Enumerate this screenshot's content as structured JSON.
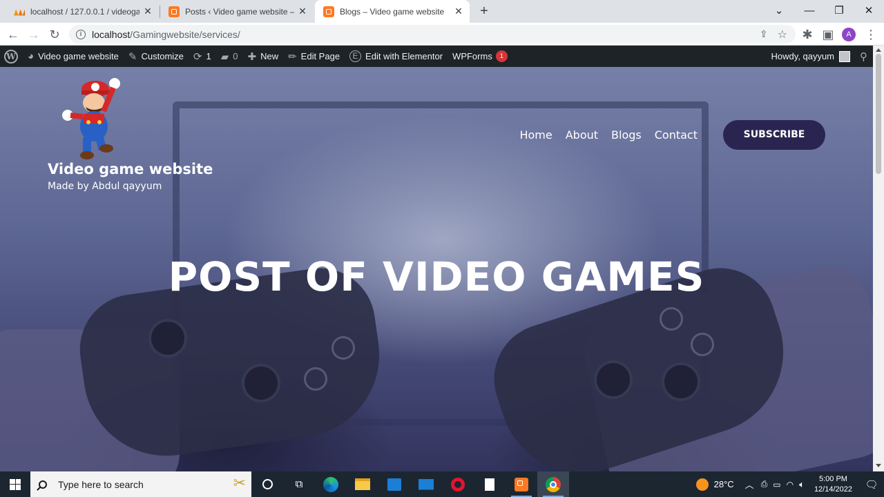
{
  "browser": {
    "tabs": [
      {
        "title": "localhost / 127.0.0.1 / videogame",
        "favicon": "phpmyadmin-icon",
        "active": false
      },
      {
        "title": "Posts ‹ Video game website — W",
        "favicon": "xampp-icon",
        "active": false
      },
      {
        "title": "Blogs – Video game website",
        "favicon": "xampp-icon",
        "active": true
      }
    ],
    "new_tab": "+",
    "url_host": "localhost",
    "url_path": "/Gamingwebsite/services/",
    "profile_initial": "A"
  },
  "wp_admin_bar": {
    "site_name": "Video game website",
    "customize": "Customize",
    "updates_count": "1",
    "comments_count": "0",
    "new": "New",
    "edit_page": "Edit Page",
    "edit_elementor": "Edit with Elementor",
    "wpforms": "WPForms",
    "wpforms_badge": "1",
    "howdy": "Howdy, qayyum"
  },
  "site": {
    "title": "Video game website",
    "tagline": "Made by Abdul qayyum",
    "nav": [
      "Home",
      "About",
      "Blogs",
      "Contact"
    ],
    "subscribe": "SUBSCRIBE",
    "headline": "POST OF VIDEO GAMES"
  },
  "taskbar": {
    "search_placeholder": "Type here to search",
    "weather": "28°C",
    "time": "5:00 PM",
    "date": "12/14/2022"
  },
  "colors": {
    "subscribe_bg": "#2a2550",
    "wp_bar_bg": "#1d2327",
    "badge_red": "#d63638",
    "taskbar_bg": "#1c2631"
  }
}
